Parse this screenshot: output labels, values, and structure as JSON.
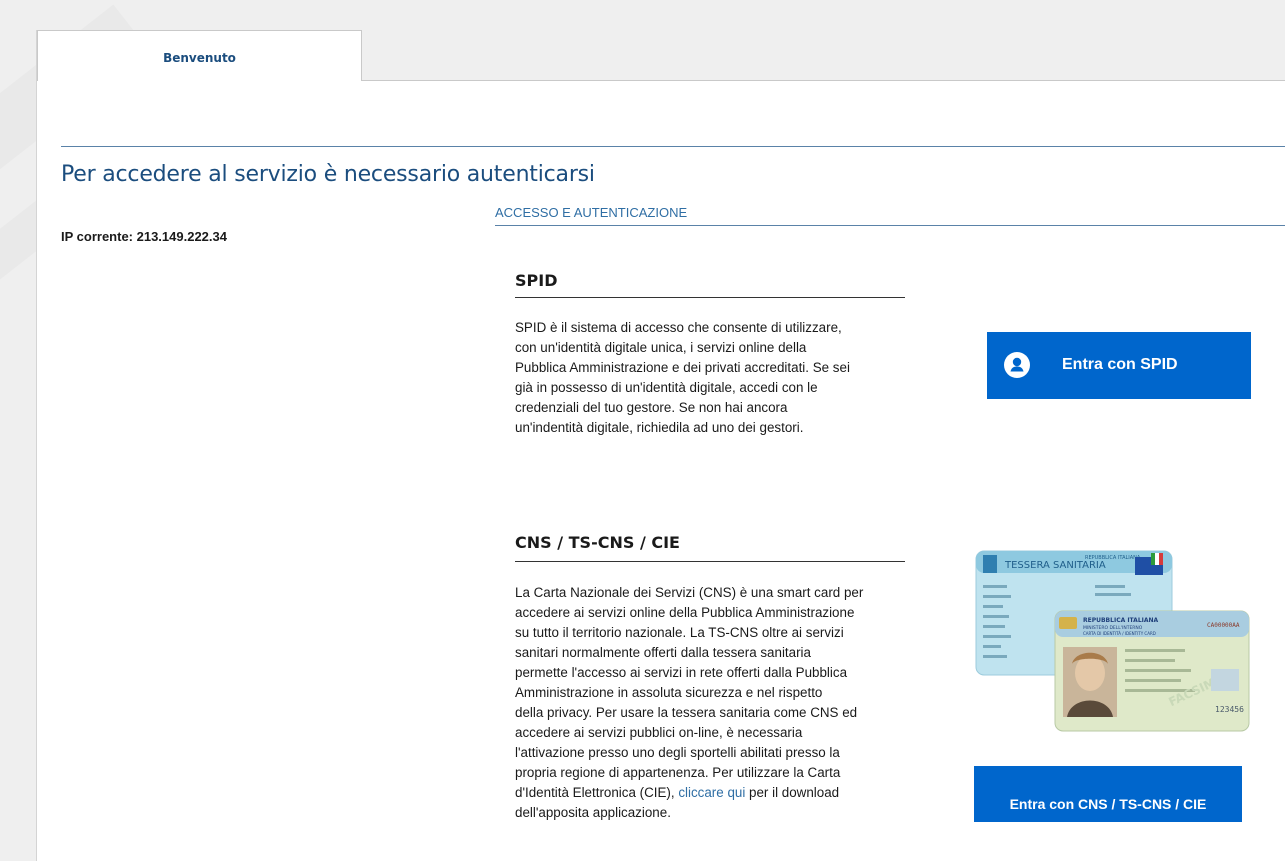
{
  "tabs": [
    {
      "label": "Benvenuto",
      "active": true
    }
  ],
  "page": {
    "title": "Per accedere al servizio è necessario autenticarsi",
    "ip_label": "IP corrente: 213.149.222.34",
    "section_header": "ACCESSO E AUTENTICAZIONE"
  },
  "spid": {
    "title": "SPID",
    "description_lines": [
      "SPID è il sistema di accesso che consente di utilizzare,",
      "con un'identità digitale unica, i servizi online della",
      "Pubblica Amministrazione e dei privati accreditati. Se sei",
      "già in possesso di un'identità digitale, accedi con le",
      "credenziali del tuo gestore. Se non hai ancora",
      "un'indentità digitale, richiedila ad uno dei gestori."
    ],
    "button_label": "Entra con SPID",
    "button_icon": "user-circle-icon"
  },
  "cns": {
    "title": "CNS / TS-CNS / CIE",
    "description_lines": [
      "La Carta Nazionale dei Servizi (CNS) è una smart card per",
      "accedere ai servizi online della Pubblica Amministrazione",
      "su tutto il territorio nazionale. La TS-CNS oltre ai servizi",
      "sanitari normalmente offerti dalla tessera sanitaria",
      "permette l'accesso ai servizi in rete offerti dalla Pubblica",
      "Amministrazione in assoluta sicurezza e nel rispetto",
      "della privacy. Per usare la tessera sanitaria come CNS ed",
      "accedere ai servizi pubblici on-line, è necessaria",
      "l'attivazione presso uno degli sportelli abilitati presso la",
      "propria regione di appartenenza. Per utilizzare la Carta"
    ],
    "last_line_before_link": "d'Identità Elettronica (CIE), ",
    "link_text": "cliccare qui",
    "last_line_after_link": " per il download",
    "final_line": "dell'apposita applicazione.",
    "button_label": "Entra con CNS / TS-CNS / CIE",
    "card_texts": {
      "health_card_title": "TESSERA SANITARIA",
      "health_card_header": "REPUBBLICA ITALIANA",
      "id_card_header": "REPUBBLICA ITALIANA",
      "id_card_subheader": "MINISTERO DELL'INTERNO",
      "id_card_type": "CARTA DI IDENTITÀ / IDENTITY CARD",
      "id_card_number": "CA00000AA",
      "id_card_watermark": "FACSIMILE",
      "id_card_code": "123456"
    }
  },
  "colors": {
    "primary_button": "#0066cc",
    "title_blue": "#1b4d7e",
    "link_blue": "#2f6ea4",
    "rule_blue": "#5a82a8"
  }
}
